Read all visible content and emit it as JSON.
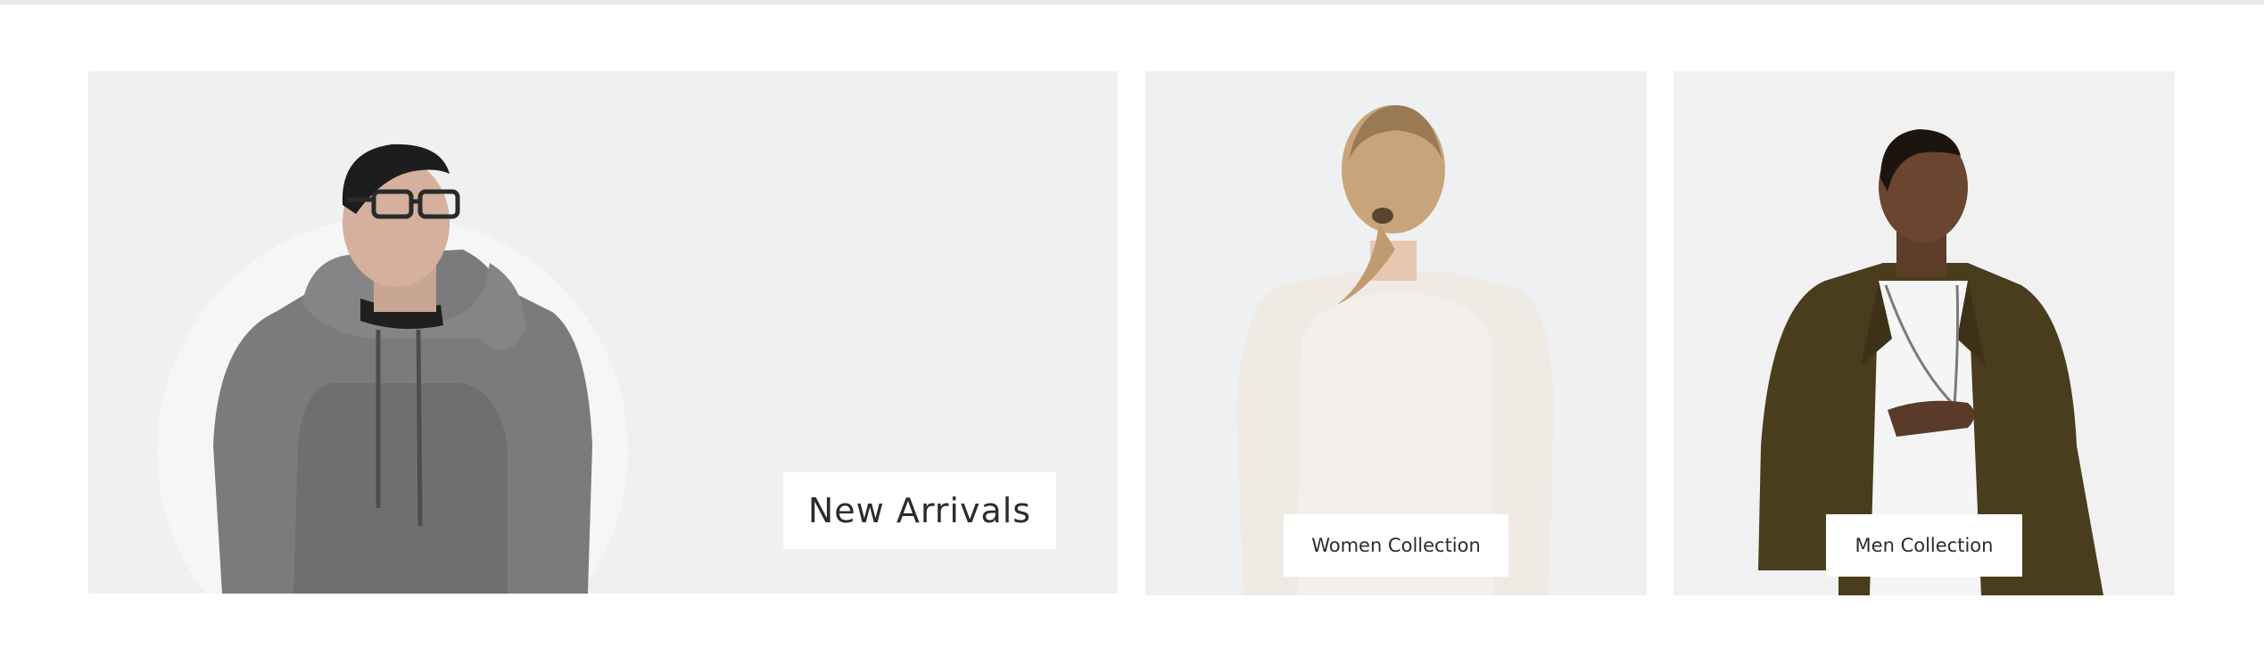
{
  "banners": {
    "new_arrivals": {
      "label": "New Arrivals",
      "figure_icon": "man-hoodie-glasses-photo"
    },
    "women": {
      "label": "Women Collection",
      "figure_icon": "woman-back-sweater-photo"
    },
    "men": {
      "label": "Men Collection",
      "figure_icon": "man-jacket-necklace-photo"
    }
  },
  "colors": {
    "banner_bg": "#f0f0f0",
    "label_bg": "#ffffff",
    "label_text": "#2b2b2b",
    "hoodie": "#7b7b7d",
    "jacket": "#4a3d1d",
    "sweater": "#efeae4"
  }
}
